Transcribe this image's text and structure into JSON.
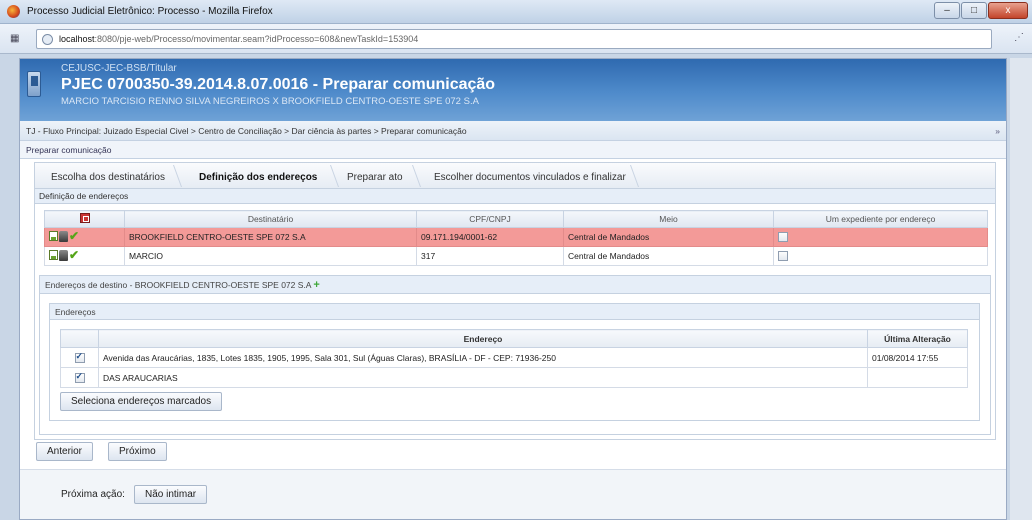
{
  "window": {
    "title": "Processo Judicial Eletrônico: Processo - Mozilla Firefox",
    "minimize": "–",
    "maximize": "□",
    "close": "x"
  },
  "browser": {
    "url_host": "localhost",
    "url_rest": ":8080/pje-web/Processo/movimentar.seam?idProcesso=608&newTaskId=153904"
  },
  "header": {
    "subtitle": "CEJUSC-JEC-BSB/Titular",
    "title": "PJEC 0700350-39.2014.8.07.0016 - Preparar comunicação",
    "parties": "MARCIO TARCISIO RENNO SILVA NEGREIROS X BROOKFIELD CENTRO-OESTE SPE 072 S.A"
  },
  "breadcrumb": {
    "path": "TJ - Fluxo Principal: Juizado Especial Civel > Centro de Conciliação > Dar ciência às partes > Preparar comunicação",
    "more": "»"
  },
  "section_title": "Preparar comunicação",
  "tabs": [
    {
      "label": "Escolha dos destinatários"
    },
    {
      "label": "Definição dos endereços"
    },
    {
      "label": "Preparar ato"
    },
    {
      "label": "Escolher documentos vinculados e finalizar"
    }
  ],
  "definicao": {
    "title": "Definição de endereços",
    "columns": [
      "Destinatário",
      "CPF/CNPJ",
      "Meio",
      "Um expediente por endereço"
    ],
    "rows": [
      {
        "destinatario": "BROOKFIELD CENTRO-OESTE SPE 072 S.A",
        "cpf": "09.171.194/0001-62",
        "meio": "Central de Mandados",
        "um_expediente": false,
        "selected": true
      },
      {
        "destinatario": "MARCIO",
        "cpf": "317",
        "meio": "Central de Mandados",
        "um_expediente": false,
        "selected": false
      }
    ]
  },
  "destino": {
    "title": "Endereços de destino - BROOKFIELD CENTRO-OESTE SPE 072 S.A",
    "add_icon": "+",
    "enderecos_title": "Endereços",
    "columns": [
      "Endereço",
      "Última Alteração"
    ],
    "rows": [
      {
        "endereco": "Avenida das Araucárias, 1835, Lotes 1835, 1905, 1995, Sala 301, Sul (Águas Claras), BRASÍLIA - DF - CEP: 71936-250",
        "alteracao": "01/08/2014 17:55",
        "checked": true
      },
      {
        "endereco": "DAS ARAUCARIAS",
        "alteracao": "",
        "checked": true
      }
    ],
    "select_button": "Seleciona endereços marcados"
  },
  "nav": {
    "anterior": "Anterior",
    "proximo": "Próximo"
  },
  "footer": {
    "label": "Próxima ação:",
    "button": "Não intimar"
  }
}
